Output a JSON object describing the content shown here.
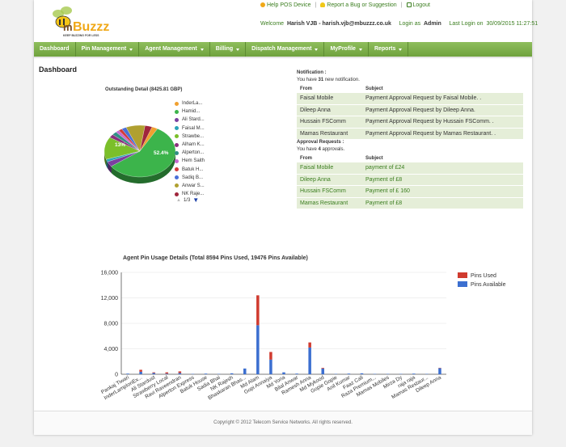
{
  "header": {
    "logo_text": "mBuzzz",
    "logo_tagline": "KEEP BUZZING FOR LESS",
    "links": [
      "Help POS Device",
      "Report a Bug or Suggestion",
      "Logout"
    ],
    "welcome_label": "Welcome",
    "user_name": "Harish VJB - harish.vjb@mbuzzz.co.uk",
    "login_as_label": "Login as",
    "role": "Admin",
    "last_login_label": "Last Login on",
    "last_login": "30/09/2015 11:27:51"
  },
  "nav": [
    {
      "label": "Dashboard",
      "caret": false
    },
    {
      "label": "Pin Management",
      "caret": true
    },
    {
      "label": "Agent Management",
      "caret": true
    },
    {
      "label": "Billing",
      "caret": true
    },
    {
      "label": "Dispatch Management",
      "caret": true
    },
    {
      "label": "MyProfile",
      "caret": true
    },
    {
      "label": "Reports",
      "caret": true
    }
  ],
  "page_title": "Dashboard",
  "outstanding": {
    "title": "Outstanding Detail (8425.81 GBP)",
    "slice_labels": [
      "52.4%",
      "13%"
    ],
    "legend": [
      {
        "name": "InderLa...",
        "color": "#f0a030"
      },
      {
        "name": "Hamid...",
        "color": "#3cb44b"
      },
      {
        "name": "Ali Stard...",
        "color": "#7b3fa0"
      },
      {
        "name": "Faisal M...",
        "color": "#2aa3b8"
      },
      {
        "name": "Strawbe...",
        "color": "#7bbf2a"
      },
      {
        "name": "Alham K...",
        "color": "#8a2f7c"
      },
      {
        "name": "Alperton...",
        "color": "#2f8f84"
      },
      {
        "name": "Hem Saith",
        "color": "#c76ad0"
      },
      {
        "name": "Batuk H...",
        "color": "#d23a3a"
      },
      {
        "name": "Sadiq B...",
        "color": "#4a6fd8"
      },
      {
        "name": "Anwar S...",
        "color": "#b0a030"
      },
      {
        "name": "NK Raje...",
        "color": "#a0263c"
      }
    ],
    "pager": "1/3"
  },
  "chart_data": [
    {
      "type": "pie",
      "title": "Outstanding Detail (8425.81 GBP)",
      "labels": [
        "InderLa...",
        "Hamid...",
        "Ali Stard...",
        "Faisal M...",
        "Strawbe...",
        "Alham K...",
        "Alperton...",
        "Hem Saith",
        "Batuk H...",
        "Sadiq B...",
        "Anwar S...",
        "NK Raje..."
      ],
      "values": [
        2.5,
        52.4,
        3,
        1.5,
        13,
        2,
        2,
        1.5,
        1.5,
        2,
        8,
        3
      ],
      "colors": [
        "#f0a030",
        "#3cb44b",
        "#7b3fa0",
        "#2aa3b8",
        "#7bbf2a",
        "#8a2f7c",
        "#2f8f84",
        "#c76ad0",
        "#d23a3a",
        "#4a6fd8",
        "#b0a030",
        "#a0263c"
      ]
    },
    {
      "type": "bar",
      "stacked": true,
      "title": "Agent Pin Usage Details (Total 8594 Pins Used, 19476 Pins Available)",
      "ylim": [
        0,
        16000
      ],
      "yticks": [
        "0",
        "4,000",
        "8,000",
        "12,000",
        "16,000"
      ],
      "legend_position": "top-right",
      "categories": [
        "Pankaj Tiwari",
        "InderLampIonEx...",
        "Ali Stardust",
        "Strawberry Local",
        "Ravi Raveendran",
        "Alperton Express",
        "Batuk House",
        "Sadia Bhai",
        "NK Rajesh",
        "Bhaskaran Bhas...",
        "Md Alam",
        "Gopi Annaiya",
        "Md Yoria",
        "Bilal Anwar",
        "Ramesh Anna",
        "Md Mykood",
        "Gopie Gopie",
        "Anil Kumar",
        "Faaz Cali",
        "Raza Premium...",
        "Mamas Mobiles",
        "Mirza Dy",
        "raja raja",
        "Mamas Restaur...",
        "Dileep Anna"
      ],
      "series": [
        {
          "name": "Pins Used",
          "color": "#d03b2f",
          "values": [
            0,
            300,
            100,
            200,
            250,
            0,
            0,
            0,
            0,
            0,
            4700,
            1200,
            0,
            0,
            800,
            100,
            0,
            0,
            0,
            0,
            0,
            0,
            0,
            0,
            50
          ]
        },
        {
          "name": "Pins Available",
          "color": "#3c6fd0",
          "values": [
            100,
            400,
            200,
            100,
            200,
            50,
            100,
            50,
            150,
            900,
            7700,
            2300,
            300,
            100,
            4200,
            900,
            50,
            100,
            150,
            50,
            50,
            50,
            100,
            50,
            950
          ]
        }
      ]
    }
  ],
  "notification": {
    "title": "Notification :",
    "subtitle": "You have 31 new notification.",
    "col_from": "From",
    "col_subject": "Subject",
    "rows": [
      {
        "from": "Faisal Mobile",
        "subject": "Payment Approval Request by Faisal Mobile. ."
      },
      {
        "from": "Dileep Anna",
        "subject": "Payment Approval Request by Dileep Anna."
      },
      {
        "from": "Hussain FSComm",
        "subject": "Payment Approval Request by Hussain FSComm. ."
      },
      {
        "from": "Mamas Restaurant",
        "subject": "Payment Approval Request by Mamas Restaurant. ."
      }
    ]
  },
  "approval": {
    "title": "Approval Requests :",
    "subtitle": "You have 4 approvals.",
    "col_from": "From",
    "col_subject": "Subject",
    "rows": [
      {
        "from": "Faisal Mobile",
        "subject": "payment of £24"
      },
      {
        "from": "Dileep Anna",
        "subject": "Payment of £8"
      },
      {
        "from": "Hussain FSComm",
        "subject": "Payment of £ 160"
      },
      {
        "from": "Mamas Restaurant",
        "subject": "Payment of £8"
      }
    ]
  },
  "footer": "Copyright © 2012 Telecom Service Networks. All rights reserved."
}
